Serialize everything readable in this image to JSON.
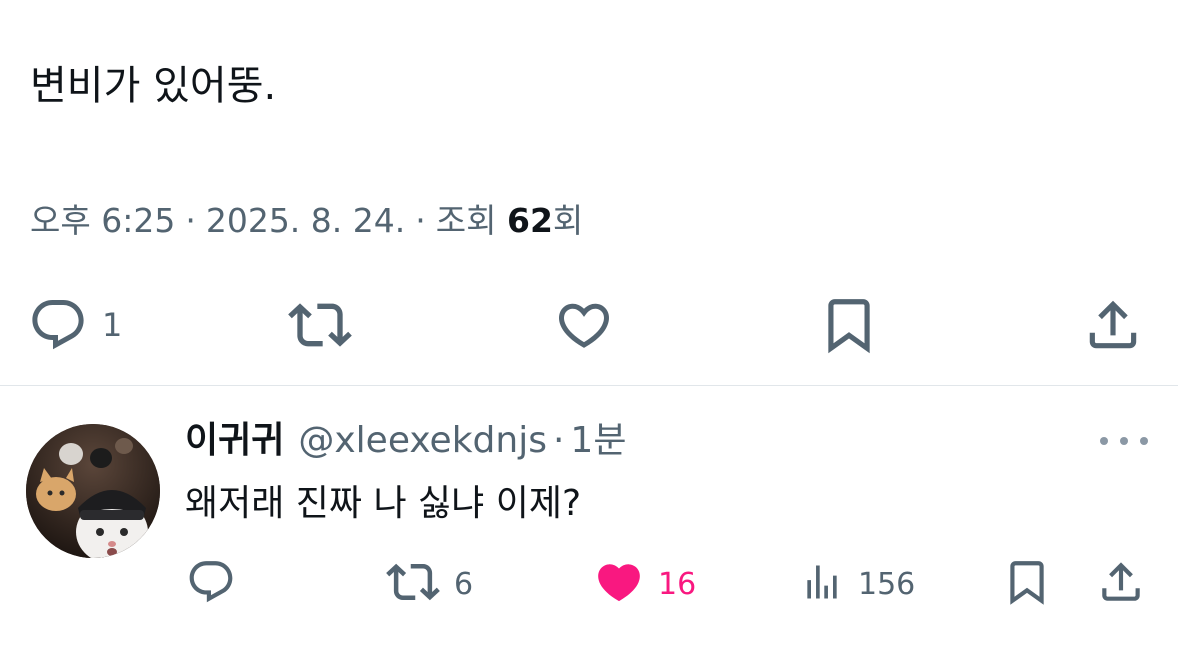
{
  "post": {
    "text": "변비가 있어뚱.",
    "time": "오후 6:25",
    "date": "2025. 8. 24.",
    "views_label": "조회",
    "views_count": "62",
    "views_suffix": "회",
    "reply_count": "1"
  },
  "reply": {
    "name": "이귀귀",
    "handle": "@xleexekdnjs",
    "time": "1분",
    "text": "왜저래 진짜 나 싫냐 이제?",
    "retweets": "6",
    "likes": "16",
    "views": "156"
  },
  "colors": {
    "text": "#0f1419",
    "secondary": "#536471",
    "like_pink": "#f91880",
    "divider": "#e1e6ea"
  },
  "icons": [
    "reply-icon",
    "retweet-icon",
    "like-icon",
    "bookmark-icon",
    "share-icon",
    "views-icon",
    "more-icon"
  ]
}
